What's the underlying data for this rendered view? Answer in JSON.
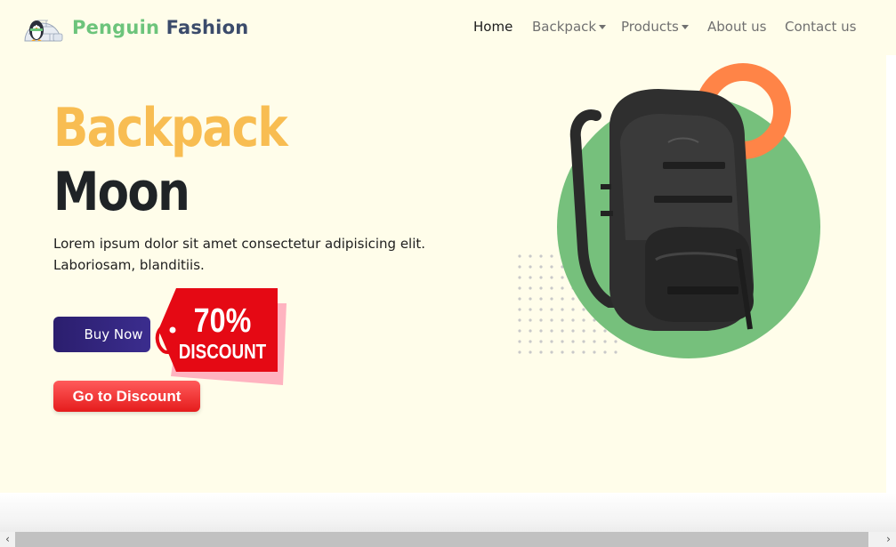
{
  "brand": {
    "name_part_1": "Penguin",
    "name_part_2": "Fashion",
    "logo_icon": "penguin-igloo-icon"
  },
  "nav": {
    "items": [
      {
        "label": "Home",
        "active": true,
        "dropdown": false
      },
      {
        "label": "Backpack",
        "active": false,
        "dropdown": true
      },
      {
        "label": "Products",
        "active": false,
        "dropdown": true
      },
      {
        "label": "About us",
        "active": false,
        "dropdown": false
      },
      {
        "label": "Contact us",
        "active": false,
        "dropdown": false
      }
    ]
  },
  "hero": {
    "title_line_1": "Backpack",
    "title_line_2": "Moon",
    "description": "Lorem ipsum dolor sit amet consectetur adipisicing elit. Laboriosam, blanditiis.",
    "buy_button_label": "Buy Now",
    "discount_tag": {
      "percent": "70%",
      "word": "DISCOUNT"
    },
    "discount_button_label": "Go to Discount",
    "product_image_icon": "backpack-icon"
  },
  "colors": {
    "page_bg": "#fffdea",
    "brand_green": "#6cc47b",
    "brand_navy": "#3b4b6b",
    "title_yellow": "#f8bd52",
    "title_dark": "#1f2326",
    "buy_button": "#2b1e6e",
    "discount_red": "#e51c1c",
    "circle_green": "#76c07c",
    "ring_orange": "#ff8447"
  },
  "scrollbar": {
    "left_arrow_icon": "chevron-left-icon",
    "right_arrow_icon": "chevron-right-icon"
  }
}
